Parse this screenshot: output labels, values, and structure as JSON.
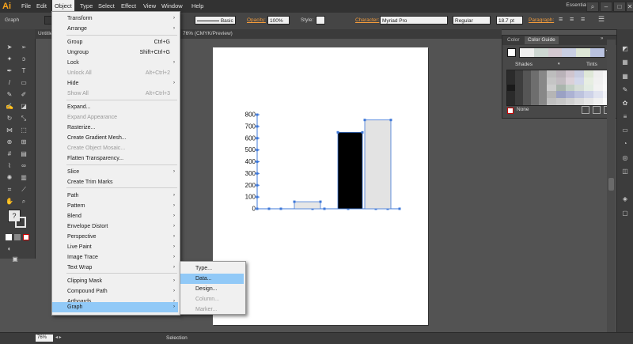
{
  "app": {
    "logo": "Ai"
  },
  "menubar": {
    "items": [
      "File",
      "Edit",
      "Object",
      "Type",
      "Select",
      "Effect",
      "View",
      "Window",
      "Help"
    ],
    "essentials": "Essentials"
  },
  "controlbar": {
    "selection_label": "Graph",
    "stroke_style": "Basic",
    "opacity_label": "Opacity:",
    "opacity_value": "100%",
    "style_label": "Style:",
    "character_label": "Character:",
    "font_family": "Myriad Pro",
    "font_style": "Regular",
    "font_size": "18.7 pt",
    "paragraph_label": "Paragraph:"
  },
  "document": {
    "tab_left": "Untitle",
    "tab_title": "76% (CMYK/Preview)"
  },
  "object_menu": {
    "items": [
      {
        "label": "Transform",
        "shortcut": "",
        "arrow": true,
        "disabled": false
      },
      {
        "label": "Arrange",
        "shortcut": "",
        "arrow": true,
        "disabled": false
      },
      {
        "label": "Group",
        "shortcut": "Ctrl+G",
        "arrow": false,
        "disabled": false
      },
      {
        "label": "Ungroup",
        "shortcut": "Shift+Ctrl+G",
        "arrow": false,
        "disabled": false
      },
      {
        "label": "Lock",
        "shortcut": "",
        "arrow": true,
        "disabled": false
      },
      {
        "label": "Unlock All",
        "shortcut": "Alt+Ctrl+2",
        "arrow": false,
        "disabled": true
      },
      {
        "label": "Hide",
        "shortcut": "",
        "arrow": true,
        "disabled": false
      },
      {
        "label": "Show All",
        "shortcut": "Alt+Ctrl+3",
        "arrow": false,
        "disabled": true
      },
      {
        "label": "Expand...",
        "shortcut": "",
        "arrow": false,
        "disabled": false
      },
      {
        "label": "Expand Appearance",
        "shortcut": "",
        "arrow": false,
        "disabled": true
      },
      {
        "label": "Rasterize...",
        "shortcut": "",
        "arrow": false,
        "disabled": false
      },
      {
        "label": "Create Gradient Mesh...",
        "shortcut": "",
        "arrow": false,
        "disabled": false
      },
      {
        "label": "Create Object Mosaic...",
        "shortcut": "",
        "arrow": false,
        "disabled": true
      },
      {
        "label": "Flatten Transparency...",
        "shortcut": "",
        "arrow": false,
        "disabled": false
      },
      {
        "label": "Slice",
        "shortcut": "",
        "arrow": true,
        "disabled": false
      },
      {
        "label": "Create Trim Marks",
        "shortcut": "",
        "arrow": false,
        "disabled": false
      },
      {
        "label": "Path",
        "shortcut": "",
        "arrow": true,
        "disabled": false
      },
      {
        "label": "Pattern",
        "shortcut": "",
        "arrow": true,
        "disabled": false
      },
      {
        "label": "Blend",
        "shortcut": "",
        "arrow": true,
        "disabled": false
      },
      {
        "label": "Envelope Distort",
        "shortcut": "",
        "arrow": true,
        "disabled": false
      },
      {
        "label": "Perspective",
        "shortcut": "",
        "arrow": true,
        "disabled": false
      },
      {
        "label": "Live Paint",
        "shortcut": "",
        "arrow": true,
        "disabled": false
      },
      {
        "label": "Image Trace",
        "shortcut": "",
        "arrow": true,
        "disabled": false
      },
      {
        "label": "Text Wrap",
        "shortcut": "",
        "arrow": true,
        "disabled": false
      },
      {
        "label": "Clipping Mask",
        "shortcut": "",
        "arrow": true,
        "disabled": false
      },
      {
        "label": "Compound Path",
        "shortcut": "",
        "arrow": true,
        "disabled": false
      },
      {
        "label": "Artboards",
        "shortcut": "",
        "arrow": true,
        "disabled": false
      },
      {
        "label": "Graph",
        "shortcut": "",
        "arrow": true,
        "disabled": false,
        "highlighted": true
      }
    ]
  },
  "graph_submenu": {
    "items": [
      {
        "label": "Type...",
        "disabled": false
      },
      {
        "label": "Data...",
        "disabled": false,
        "highlighted": true
      },
      {
        "label": "Design...",
        "disabled": false
      },
      {
        "label": "Column...",
        "disabled": true
      },
      {
        "label": "Marker...",
        "disabled": true
      }
    ]
  },
  "graph_on_canvas": {
    "y_ticks": [
      "800",
      "700",
      "600",
      "500",
      "400",
      "300",
      "200",
      "100",
      "0"
    ]
  },
  "chart_data": {
    "type": "bar",
    "categories": [
      "",
      "",
      ""
    ],
    "values": [
      60,
      650,
      755
    ],
    "colors": [
      "#e6e6e6",
      "#000000",
      "#e3e3e3"
    ],
    "ylim": [
      0,
      800
    ],
    "yticks": [
      0,
      100,
      200,
      300,
      400,
      500,
      600,
      700,
      800
    ],
    "title": "",
    "xlabel": "",
    "ylabel": ""
  },
  "color_guide_panel": {
    "tabs": [
      "Color",
      "Color Guide"
    ],
    "shades_label": "Shades",
    "tints_label": "Tints",
    "none_label": "None"
  },
  "statusbar": {
    "zoom": "76%",
    "tool": "Selection"
  },
  "colors": {
    "accent_link": "#f29b3b",
    "menu_highlight": "#91c9f7",
    "selection_blue": "#3f78d8"
  }
}
